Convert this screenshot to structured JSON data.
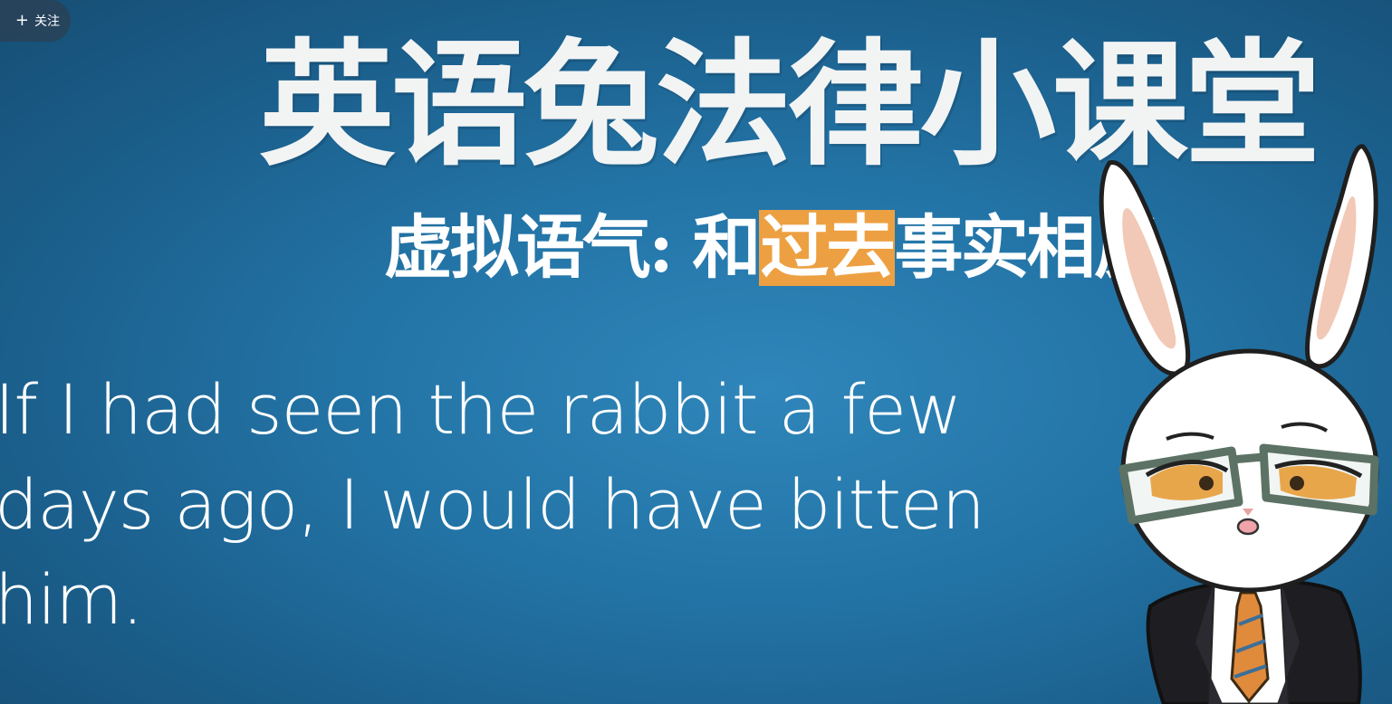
{
  "follow_button": {
    "icon": "plus-icon",
    "label": "关注"
  },
  "slide": {
    "title": "英语兔法律小课堂",
    "subtitle_parts": {
      "before": "虚拟语气: 和",
      "highlight": "过去",
      "after": "事实相反"
    },
    "highlight_color": "#eda041",
    "sentence": "If I had seen the rabbit a few days ago, I would have bitten him."
  },
  "mascot": {
    "icon": "rabbit-mascot-icon"
  }
}
